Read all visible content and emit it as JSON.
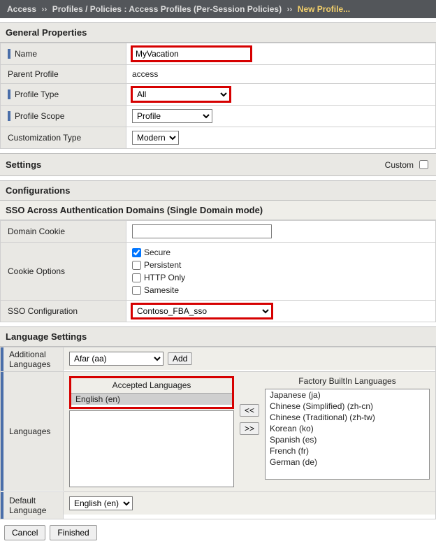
{
  "breadcrumb": {
    "root": "Access",
    "sep": "››",
    "mid": "Profiles / Policies : Access Profiles (Per-Session Policies)",
    "current": "New Profile..."
  },
  "sections": {
    "general": "General Properties",
    "settings": "Settings",
    "custom_label": "Custom",
    "configurations": "Configurations",
    "sso_header": "SSO Across Authentication Domains (Single Domain mode)",
    "lang_header": "Language Settings"
  },
  "general": {
    "name_label": "Name",
    "name_value": "MyVacation",
    "parent_label": "Parent Profile",
    "parent_value": "access",
    "type_label": "Profile Type",
    "type_value": "All",
    "scope_label": "Profile Scope",
    "scope_value": "Profile",
    "cust_label": "Customization Type",
    "cust_value": "Modern"
  },
  "sso": {
    "domain_cookie_label": "Domain Cookie",
    "domain_cookie_value": "",
    "cookie_opts_label": "Cookie Options",
    "opt_secure": "Secure",
    "opt_persistent": "Persistent",
    "opt_httponly": "HTTP Only",
    "opt_samesite": "Samesite",
    "config_label": "SSO Configuration",
    "config_value": "Contoso_FBA_sso"
  },
  "lang": {
    "additional_label": "Additional Languages",
    "additional_value": "Afar (aa)",
    "add_btn": "Add",
    "languages_label": "Languages",
    "accepted_title": "Accepted Languages",
    "factory_title": "Factory BuiltIn Languages",
    "accepted_items": [
      "English (en)"
    ],
    "factory_items": [
      "Japanese (ja)",
      "Chinese (Simplified) (zh-cn)",
      "Chinese (Traditional) (zh-tw)",
      "Korean (ko)",
      "Spanish (es)",
      "French (fr)",
      "German (de)"
    ],
    "move_left": "<<",
    "move_right": ">>",
    "default_label": "Default Language",
    "default_value": "English (en)"
  },
  "footer": {
    "cancel": "Cancel",
    "finished": "Finished"
  }
}
